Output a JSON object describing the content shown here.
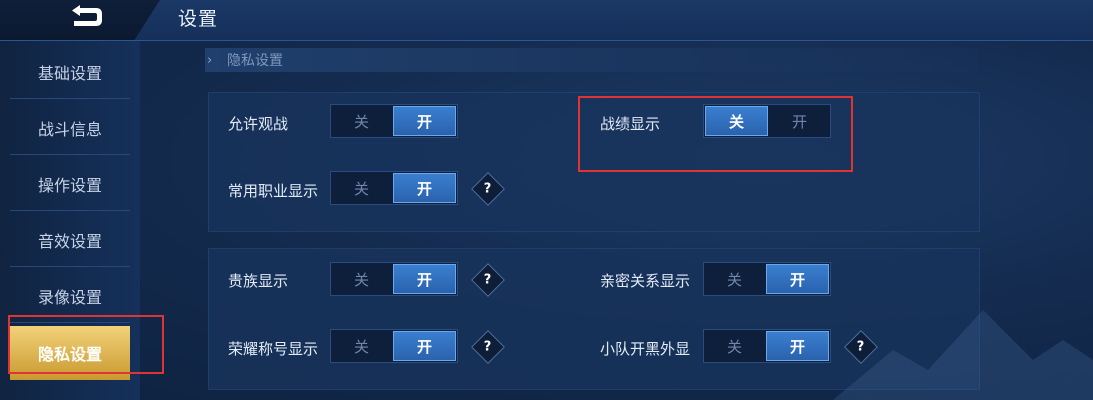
{
  "header": {
    "title": "设置"
  },
  "sidebar": {
    "items": [
      {
        "label": "基础设置"
      },
      {
        "label": "战斗信息"
      },
      {
        "label": "操作设置"
      },
      {
        "label": "音效设置"
      },
      {
        "label": "录像设置"
      },
      {
        "label": "隐私设置",
        "active": true
      }
    ]
  },
  "section": {
    "title": "隐私设置"
  },
  "settings": {
    "allow_spectate": {
      "label": "允许观战",
      "off": "关",
      "on": "开",
      "value": "开"
    },
    "record_display": {
      "label": "战绩显示",
      "off": "关",
      "on": "开",
      "value": "关"
    },
    "common_role": {
      "label": "常用职业显示",
      "off": "关",
      "on": "开",
      "value": "开"
    },
    "noble_display": {
      "label": "贵族显示",
      "off": "关",
      "on": "开",
      "value": "开"
    },
    "intimacy_display": {
      "label": "亲密关系显示",
      "off": "关",
      "on": "开",
      "value": "开"
    },
    "honor_title": {
      "label": "荣耀称号显示",
      "off": "关",
      "on": "开",
      "value": "开"
    },
    "squad_display": {
      "label": "小队开黑外显",
      "off": "关",
      "on": "开",
      "value": "开"
    }
  },
  "help_glyph": "?",
  "colors": {
    "accent": "#3a7fd0",
    "highlight": "#e03434",
    "active_tab": "#e6be5a"
  }
}
